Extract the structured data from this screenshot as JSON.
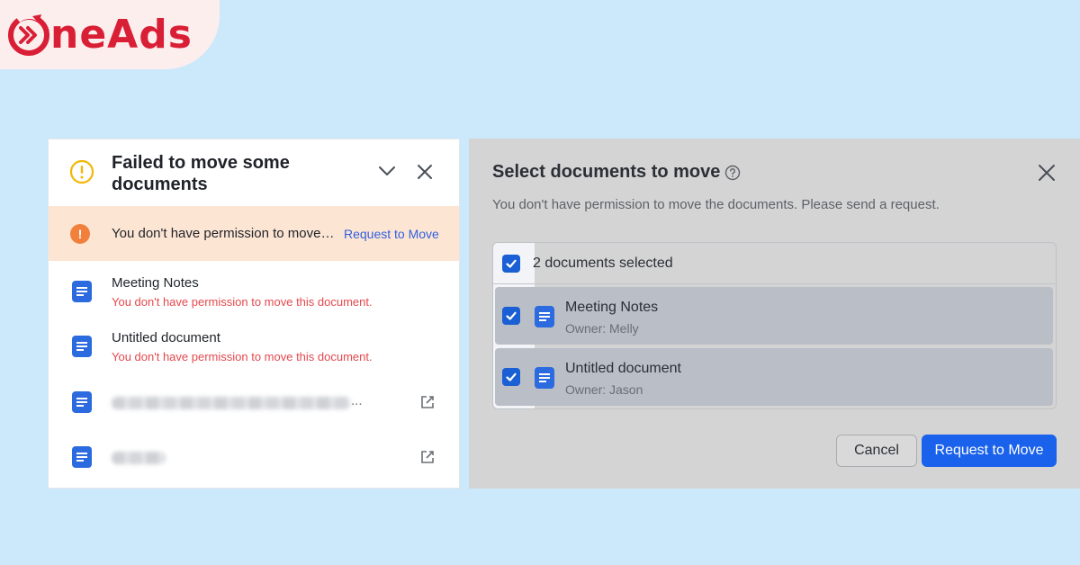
{
  "brand": {
    "logo_text": "neAds",
    "logo_color": "#d91f35"
  },
  "left_card": {
    "title": "Failed to move some documents",
    "banner": {
      "message": "You don't have permission to move the documents.",
      "link_label": "Request to Move"
    },
    "items": [
      {
        "name": "Meeting Notes",
        "error": "You don't have permission to move this document."
      },
      {
        "name": "Untitled document",
        "error": "You don't have permission to move this document."
      },
      {
        "name_hidden": true,
        "ellipsis": "..."
      },
      {
        "name_hidden": true
      }
    ],
    "icons": {
      "header": "warning-circle-icon",
      "collapse": "chevron-down-icon",
      "close": "close-icon",
      "banner": "error-circle-icon",
      "document": "document-icon",
      "open": "open-external-icon"
    }
  },
  "dialog": {
    "title": "Select documents to move",
    "subtitle": "You don't have permission to move the documents. Please send a request.",
    "selected_summary": "2 documents selected",
    "documents": [
      {
        "name": "Meeting Notes",
        "owner": "Owner: Melly",
        "checked": true
      },
      {
        "name": "Untitled document",
        "owner": "Owner: Jason",
        "checked": true
      }
    ],
    "cancel_label": "Cancel",
    "submit_label": "Request to Move",
    "colors": {
      "primary": "#1a62eb",
      "checkbox": "#1a5fd4",
      "document_icon": "#2b6bdf"
    }
  }
}
